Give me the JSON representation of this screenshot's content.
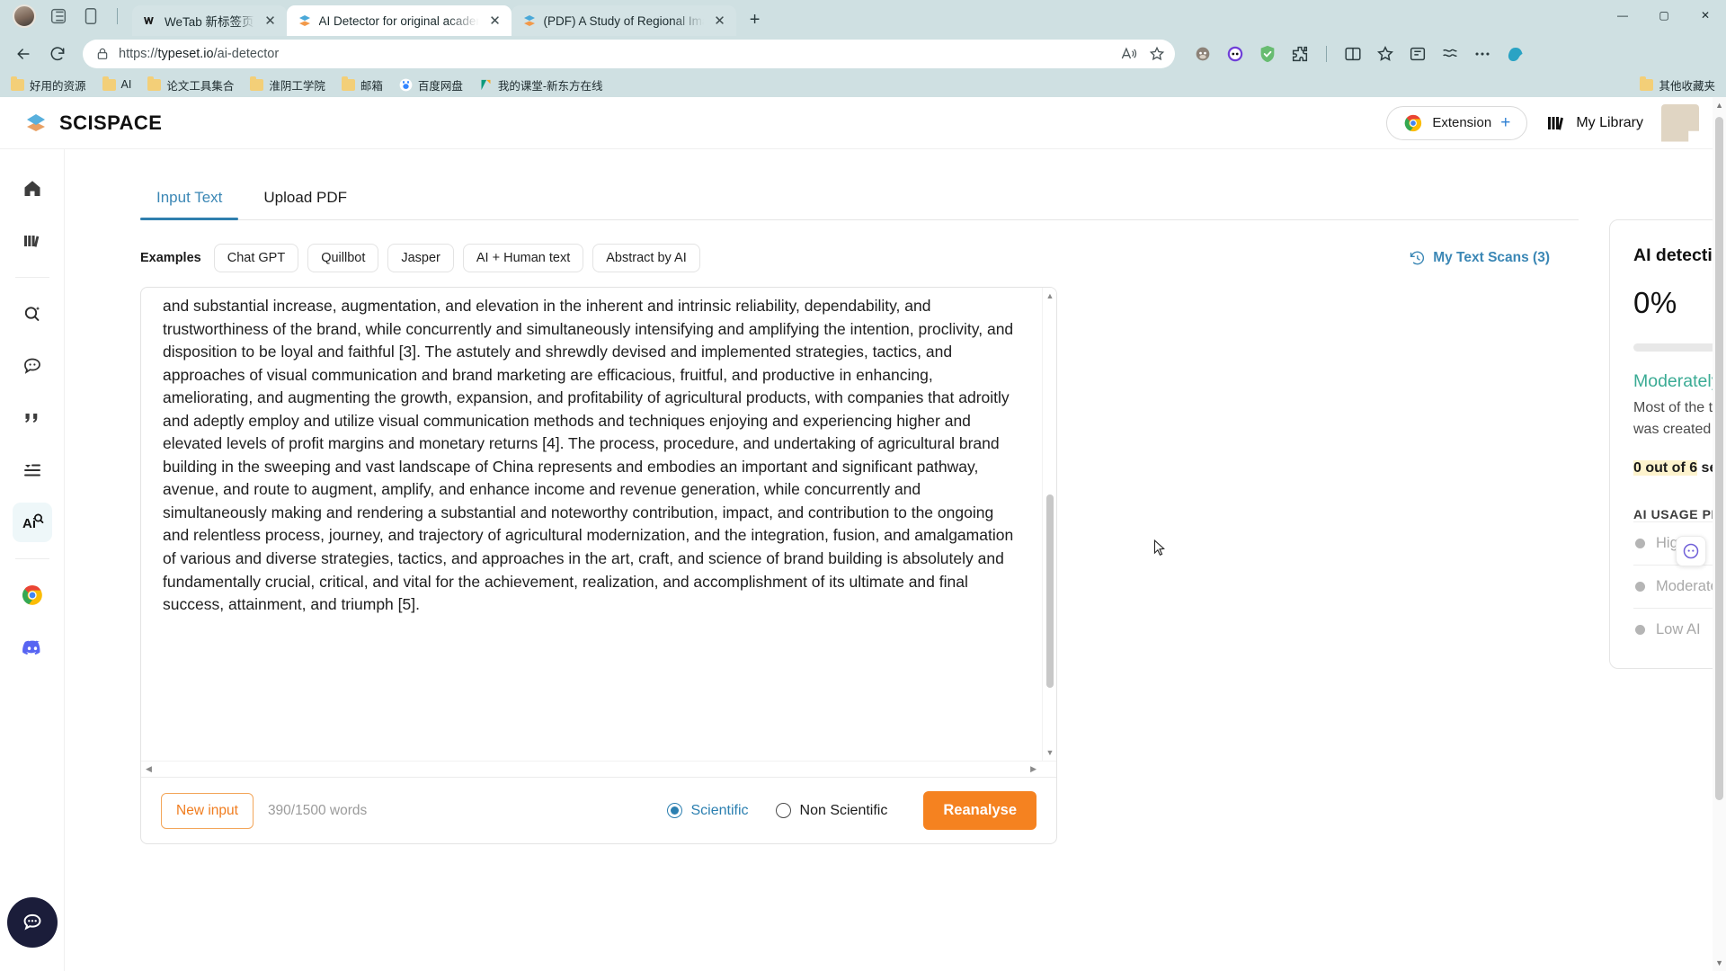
{
  "browser": {
    "tabs": [
      {
        "title": "WeTab 新标签页",
        "favicon": "wetab-icon",
        "active": false,
        "close_label": "✕"
      },
      {
        "title": "AI Detector for original academic",
        "favicon": "scispace-icon",
        "active": true,
        "close_label": "✕"
      },
      {
        "title": "(PDF) A Study of Regional Image",
        "favicon": "scispace-icon",
        "active": false,
        "close_label": "✕"
      }
    ],
    "new_tab_label": "+",
    "window_controls": {
      "minimize": "—",
      "maximize": "▢",
      "close": "✕"
    },
    "nav": {
      "back": "back-icon",
      "reload": "reload-icon"
    },
    "omnibox": {
      "lock": "lock-icon",
      "url_scheme": "https://",
      "url_host": "typeset.io",
      "url_path": "/ai-detector",
      "read_aloud": "read-aloud-icon",
      "favorite": "star-icon"
    },
    "toolbar_icons": [
      "monkey-extension-icon",
      "eyes-extension-icon",
      "adguard-shield-icon",
      "extensions-puzzle-icon",
      "split-screen-icon",
      "collections-icon",
      "browser-essentials-icon",
      "settings-more-icon",
      "copilot-icon"
    ],
    "bookmarks": [
      {
        "label": "好用的资源",
        "icon": "folder-icon"
      },
      {
        "label": "AI",
        "icon": "folder-icon"
      },
      {
        "label": "论文工具集合",
        "icon": "folder-icon"
      },
      {
        "label": "淮阴工学院",
        "icon": "folder-icon"
      },
      {
        "label": "邮箱",
        "icon": "folder-icon"
      },
      {
        "label": "百度网盘",
        "icon": "baidu-pan-icon"
      },
      {
        "label": "我的课堂-新东方在线",
        "icon": "xdf-icon"
      }
    ],
    "bookmarks_overflow": {
      "label": "其他收藏夹",
      "icon": "folder-icon"
    }
  },
  "header": {
    "logo_icon": "scispace-logo-icon",
    "brand": "SCISPACE",
    "extension_button": {
      "label": "Extension",
      "plus": "+",
      "icon": "chrome-icon"
    },
    "my_library": {
      "label": "My Library",
      "icon": "library-icon"
    },
    "avatar": "user-avatar"
  },
  "sidebar": {
    "items": [
      {
        "name": "home",
        "icon": "home-icon"
      },
      {
        "name": "library",
        "icon": "library-icon"
      },
      {
        "name": "literature-review",
        "icon": "search-sparkle-icon"
      },
      {
        "name": "chat-pdf",
        "icon": "chat-bubble-icon"
      },
      {
        "name": "citation-generator",
        "icon": "quote-icon"
      },
      {
        "name": "paraphraser",
        "icon": "list-indent-icon"
      },
      {
        "name": "ai-detector",
        "icon": "ai-detector-icon",
        "active": true
      },
      {
        "name": "chrome-extension",
        "icon": "chrome-icon"
      },
      {
        "name": "discord",
        "icon": "discord-icon"
      }
    ],
    "help_fab": "chat-support-icon"
  },
  "main": {
    "tabs": [
      {
        "label": "Input Text",
        "active": true
      },
      {
        "label": "Upload PDF",
        "active": false
      }
    ],
    "examples_label": "Examples",
    "example_chips": [
      "Chat GPT",
      "Quillbot",
      "Jasper",
      "AI + Human text",
      "Abstract by AI"
    ],
    "my_text_scans": {
      "label": "My Text Scans (3)",
      "icon": "history-icon"
    },
    "editor": {
      "text": "and substantial increase, augmentation, and elevation in the inherent and intrinsic reliability, dependability, and trustworthiness of the brand, while concurrently and simultaneously intensifying and amplifying the intention, proclivity, and disposition to be loyal and faithful [3]. The astutely and shrewdly devised and implemented strategies, tactics, and approaches of visual communication and brand marketing are efficacious, fruitful, and productive in enhancing, ameliorating, and augmenting the growth, expansion, and profitability of agricultural products, with companies that adroitly and adeptly employ and utilize visual communication methods and techniques enjoying and experiencing higher and elevated levels of profit margins and monetary returns [4]. The process, procedure, and undertaking of agricultural brand building in the sweeping and vast landscape of China represents and embodies an important and significant pathway, avenue, and route to augment, amplify, and enhance income and revenue generation, while concurrently and simultaneously making and rendering a substantial and noteworthy contribution, impact, and contribution to the ongoing and relentless process, journey, and trajectory of agricultural modernization, and the integration, fusion, and amalgamation of various and diverse strategies, tactics, and approaches in the art, craft, and science of brand building is absolutely and fundamentally crucial, critical, and vital for the achievement, realization, and accomplishment of its ultimate and final success, attainment, and triumph [5]."
    },
    "footer": {
      "new_input_label": "New input",
      "word_count": "390/1500 words",
      "radios": [
        {
          "label": "Scientific",
          "selected": true
        },
        {
          "label": "Non Scientific",
          "selected": false
        }
      ],
      "reanalyse_label": "Reanalyse"
    }
  },
  "report": {
    "title": "AI detection report",
    "score": "0%",
    "verdict": "Moderately Human",
    "verdict_color": "#3aab94",
    "description": "Most of the text is written by a human. Some portion of the text was created with the help of AI",
    "sentences_highlight": "0 out of 6",
    "sentences_rest": " sentences were AI written.",
    "probability_title": "AI USAGE PROBABILITY",
    "probability_rows": [
      {
        "label": "High AI"
      },
      {
        "label": "Moderate AI"
      },
      {
        "label": "Low AI"
      }
    ]
  },
  "misc": {
    "side_widget_icon": "feedback-widget-icon",
    "scroll_up_arrow": "▲",
    "scroll_down_arrow": "▼",
    "scroll_left_arrow": "◀",
    "scroll_right_arrow": "▶"
  }
}
